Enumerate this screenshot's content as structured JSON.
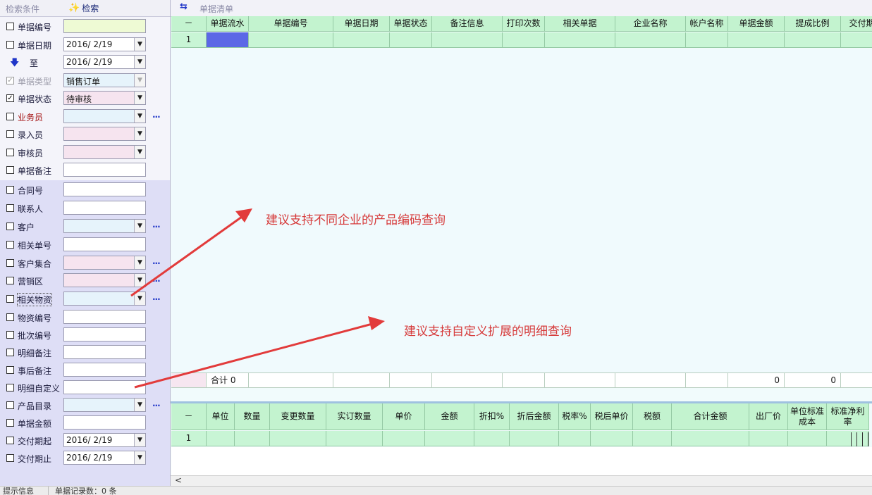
{
  "left_panel": {
    "title": "检索条件",
    "search_label": "检索",
    "rows": [
      {
        "label": "单据编号",
        "checked": false,
        "field_type": "text",
        "value": "",
        "bg": "yellow",
        "more": false
      },
      {
        "label": "单据日期",
        "checked": false,
        "field_type": "combo",
        "value": "2016/  2/19",
        "bg": "white",
        "more": false
      },
      {
        "label": "至",
        "checked": null,
        "field_type": "combo",
        "value": "2016/  2/19",
        "bg": "white",
        "more": false
      },
      {
        "label": "单据类型",
        "checked": true,
        "disabled": true,
        "field_type": "combo",
        "value": "销售订单",
        "bg": "blue",
        "more": false
      },
      {
        "label": "单据状态",
        "checked": true,
        "field_type": "combo",
        "value": "待审核",
        "bg": "pink",
        "more": false
      },
      {
        "label": "业务员",
        "checked": false,
        "field_type": "combo",
        "value": "",
        "bg": "blue",
        "more": true
      },
      {
        "label": "录入员",
        "checked": false,
        "field_type": "combo",
        "value": "",
        "bg": "pink",
        "more": false
      },
      {
        "label": "审核员",
        "checked": false,
        "field_type": "combo",
        "value": "",
        "bg": "pink",
        "more": false
      },
      {
        "label": "单据备注",
        "checked": false,
        "field_type": "text",
        "value": "",
        "bg": "white",
        "more": false
      },
      {
        "label": "合同号",
        "checked": false,
        "field_type": "text",
        "value": "",
        "bg": "white",
        "more": false
      },
      {
        "label": "联系人",
        "checked": false,
        "field_type": "text",
        "value": "",
        "bg": "white",
        "more": false
      },
      {
        "label": "客户",
        "checked": false,
        "field_type": "combo",
        "value": "",
        "bg": "blue",
        "more": true
      },
      {
        "label": "相关单号",
        "checked": false,
        "field_type": "text",
        "value": "",
        "bg": "white",
        "more": false
      },
      {
        "label": "客户集合",
        "checked": false,
        "field_type": "combo",
        "value": "",
        "bg": "pink",
        "more": true
      },
      {
        "label": "营销区",
        "checked": false,
        "field_type": "combo",
        "value": "",
        "bg": "pink",
        "more": true
      },
      {
        "label": "相关物资",
        "checked": false,
        "field_type": "combo",
        "value": "",
        "bg": "blue",
        "more": true
      },
      {
        "label": "物资编号",
        "checked": false,
        "field_type": "text",
        "value": "",
        "bg": "white",
        "more": false
      },
      {
        "label": "批次编号",
        "checked": false,
        "field_type": "text",
        "value": "",
        "bg": "white",
        "more": false
      },
      {
        "label": "明细备注",
        "checked": false,
        "field_type": "text",
        "value": "",
        "bg": "white",
        "more": false
      },
      {
        "label": "事后备注",
        "checked": false,
        "field_type": "text",
        "value": "",
        "bg": "white",
        "more": false
      },
      {
        "label": "明细自定义",
        "checked": false,
        "field_type": "text",
        "value": "",
        "bg": "white",
        "more": false
      },
      {
        "label": "产品目录",
        "checked": false,
        "field_type": "combo",
        "value": "",
        "bg": "blue",
        "more": true
      },
      {
        "label": "单据金额",
        "checked": false,
        "field_type": "text",
        "value": "",
        "bg": "white",
        "more": false
      },
      {
        "label": "交付期起",
        "checked": false,
        "field_type": "combo",
        "value": "2016/  2/19",
        "bg": "white",
        "more": false
      },
      {
        "label": "交付期止",
        "checked": false,
        "field_type": "combo",
        "value": "2016/  2/19",
        "bg": "white",
        "more": false
      }
    ],
    "more_glyph": "..."
  },
  "right_panel": {
    "title": "单据清单",
    "top_grid": {
      "corner": "－",
      "columns": [
        "单据流水",
        "单据编号",
        "单据日期",
        "单据状态",
        "备注信息",
        "打印次数",
        "相关单据",
        "企业名称",
        "帐户名称",
        "单据金额",
        "提成比例",
        "交付期"
      ],
      "row_number": "1",
      "totals": {
        "label": "合计 0",
        "amount": "0",
        "ratio": "0"
      }
    },
    "bottom_grid": {
      "corner": "－",
      "columns": [
        "单位",
        "数量",
        "变更数量",
        "实订数量",
        "单价",
        "金额",
        "折扣%",
        "折后金额",
        "税率%",
        "税后单价",
        "税额",
        "合计金额",
        "出厂价",
        "单位标准成本",
        "标准净利率"
      ],
      "row_number": "1"
    },
    "scroll_left": "<"
  },
  "status_bar": {
    "left": "提示信息",
    "right": "单据记录数：0 条"
  },
  "annotations": [
    {
      "text": "建议支持不同企业的产品编码查询"
    },
    {
      "text": "建议支持自定义扩展的明细查询"
    }
  ],
  "colors": {
    "annotation": "#d63a3a",
    "grid_header": "#c3f3cf",
    "selection": "#5c68e6"
  }
}
